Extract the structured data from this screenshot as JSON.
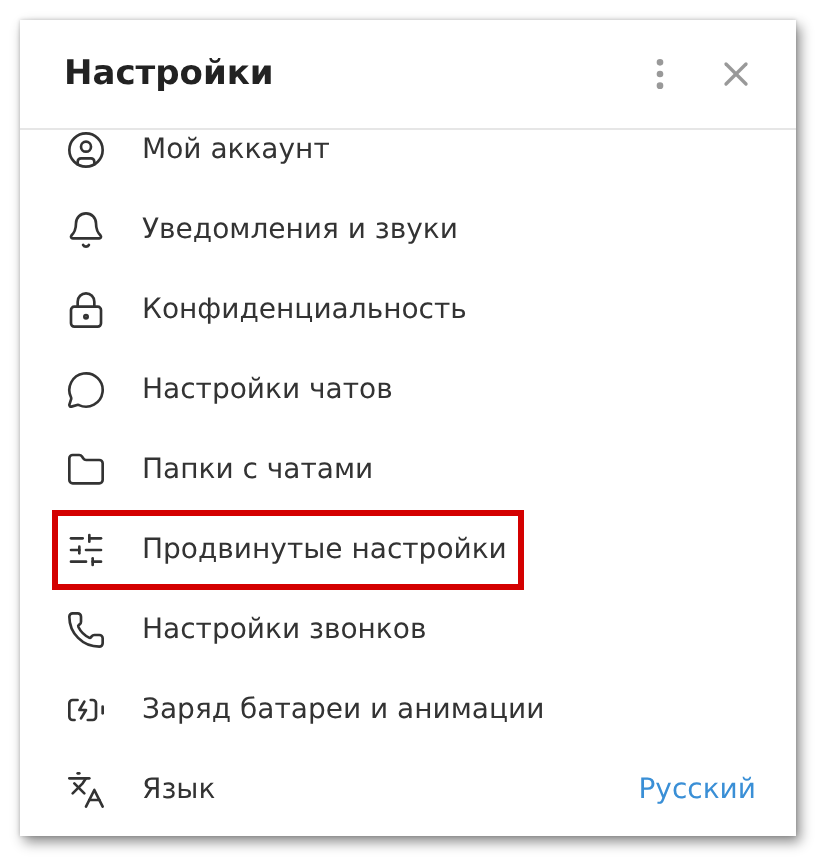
{
  "window": {
    "title": "Настройки"
  },
  "items": [
    {
      "label": "Мой аккаунт",
      "highlighted": false
    },
    {
      "label": "Уведомления и звуки",
      "highlighted": false
    },
    {
      "label": "Конфиденциальность",
      "highlighted": false
    },
    {
      "label": "Настройки чатов",
      "highlighted": false
    },
    {
      "label": "Папки с чатами",
      "highlighted": false
    },
    {
      "label": "Продвинутые настройки",
      "highlighted": true
    },
    {
      "label": "Настройки звонков",
      "highlighted": false
    },
    {
      "label": "Заряд батареи и анимации",
      "highlighted": false
    },
    {
      "label": "Язык",
      "highlighted": false,
      "value": "Русский"
    }
  ]
}
